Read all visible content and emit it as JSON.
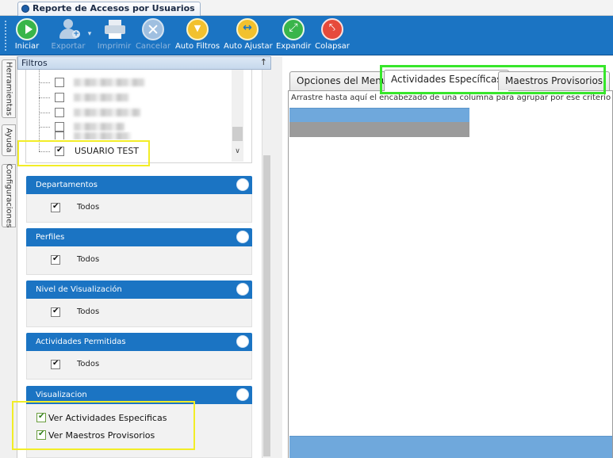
{
  "window": {
    "tab_title": "Reporte de Accesos por Usuarios"
  },
  "toolbar": {
    "buttons": [
      {
        "label": "Iniciar",
        "icon": "play-icon",
        "enabled": true
      },
      {
        "label": "Exportar",
        "icon": "add-user-icon",
        "enabled": false
      },
      {
        "label": "Imprimir",
        "icon": "printer-icon",
        "enabled": false
      },
      {
        "label": "Cancelar",
        "icon": "cancel-icon",
        "enabled": false
      },
      {
        "label": "Auto Filtros",
        "icon": "auto-filter-icon",
        "enabled": true
      },
      {
        "label": "Auto Ajustar",
        "icon": "auto-adjust-icon",
        "enabled": true
      },
      {
        "label": "Expandir",
        "icon": "expand-icon",
        "enabled": true
      },
      {
        "label": "Colapsar",
        "icon": "collapse-icon",
        "enabled": true
      }
    ]
  },
  "side_tabs": [
    "Herramientas",
    "Ayuda",
    "Configuraciones"
  ],
  "filters": {
    "title": "Filtros",
    "pin": "↑",
    "users": [
      {
        "checked": false,
        "name": ""
      },
      {
        "checked": false,
        "name": ""
      },
      {
        "checked": false,
        "name": ""
      },
      {
        "checked": false,
        "name": ""
      },
      {
        "checked": false,
        "name": ""
      },
      {
        "checked": true,
        "name": "USUARIO TEST"
      }
    ],
    "scroll_arrow": "∨",
    "groups": [
      {
        "title": "Departamentos",
        "option": "Todos",
        "checked": true
      },
      {
        "title": "Perfiles",
        "option": "Todos",
        "checked": true
      },
      {
        "title": "Nivel de Visualización",
        "option": "Todos",
        "checked": true
      },
      {
        "title": "Actividades Permitidas",
        "option": "Todos",
        "checked": true
      }
    ],
    "visualizacion": {
      "title": "Visualizacion",
      "options": [
        {
          "label": "Ver Actividades Especificas",
          "checked": true
        },
        {
          "label": "Ver Maestros Provisorios",
          "checked": true
        }
      ]
    }
  },
  "result_tabs": [
    {
      "label": "Opciones del Menú",
      "active": false
    },
    {
      "label": "Actividades Específicas",
      "active": true
    },
    {
      "label": "Maestros Provisorios",
      "active": false
    }
  ],
  "grid": {
    "group_hint": "Arrastre hasta aquí el encabezado de una columna para agrupar por ese criterio"
  },
  "colors": {
    "accent": "#1b74c3",
    "highlight_yellow": "#f2ed27",
    "highlight_green": "#37e62b"
  }
}
